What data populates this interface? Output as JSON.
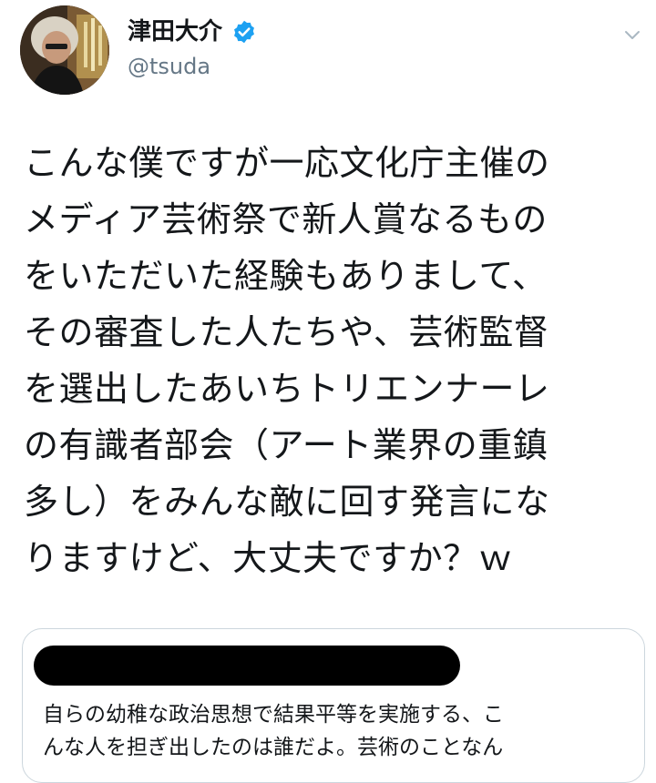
{
  "author": {
    "display_name": "津田大介",
    "handle": "@tsuda",
    "verified_icon": "verified-badge-icon",
    "avatar_icon": "avatar"
  },
  "menu": {
    "caret_icon": "chevron-down-icon"
  },
  "tweet": {
    "lines": [
      "こんな僕ですが一応文化庁主催の",
      "メディア芸術祭で新人賞なるもの",
      "をいただいた経験もありまして、",
      "その審査した人たちや、芸術監督",
      "を選出したあいちトリエンナーレ",
      "の有識者部会（アート業界の重鎮",
      "多し）をみんな敵に回す発言にな",
      "りますけど、大丈夫ですか？ｗ"
    ]
  },
  "quoted_tweet": {
    "author_redacted": true,
    "lines": [
      "自らの幼稚な政治思想で結果平等を実施する、こ",
      "んな人を担ぎ出したのは誰だよ。芸術のことなん"
    ]
  },
  "colors": {
    "text": "#14171a",
    "secondary": "#657786",
    "verified": "#1da1f2",
    "border": "#ccd6dd",
    "redaction": "#000000"
  }
}
